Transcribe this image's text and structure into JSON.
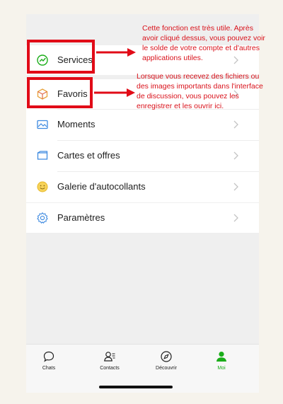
{
  "menu": {
    "services": "Services",
    "favoris": "Favoris",
    "moments": "Moments",
    "cartes": "Cartes et offres",
    "galerie": "Galerie d'autocollants",
    "parametres": "Paramètres"
  },
  "tabbar": {
    "chats": "Chats",
    "contacts": "Contacts",
    "decouvrir": "Découvrir",
    "moi": "Moi"
  },
  "annotations": {
    "services_note": [
      "Cette fonction est très utile. Après",
      "avoir cliqué dessus, vous pouvez voir",
      "le solde de votre compte et d'autres",
      "applications utiles."
    ],
    "favoris_note": [
      "Lorsque vous recevez des fichiers ou",
      "des images importants dans l'interface",
      "de discussion, vous pouvez les",
      "enregistrer et les ouvrir ici."
    ]
  },
  "colors": {
    "accent_green": "#1aad19",
    "annotation_red": "#e10b17",
    "background": "#efefef"
  }
}
